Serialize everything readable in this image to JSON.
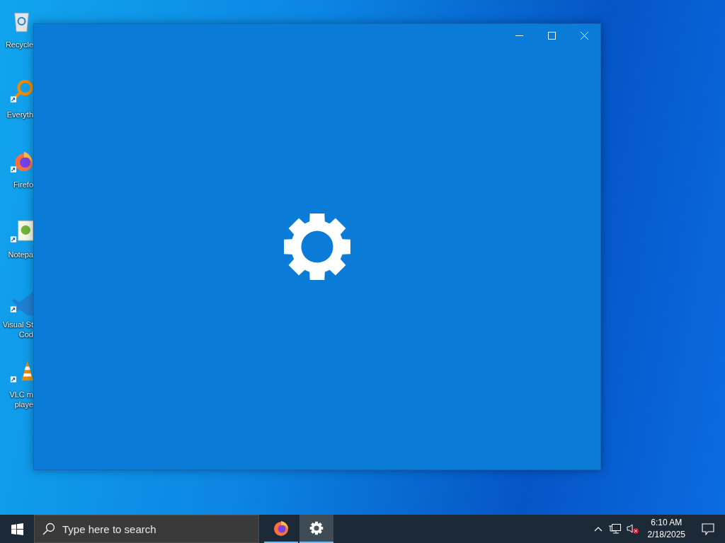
{
  "desktop_icons": [
    {
      "kind": "recycle-bin",
      "lines": [
        "Recycle"
      ]
    },
    {
      "kind": "search-app",
      "lines": [
        "Everyth"
      ]
    },
    {
      "kind": "browser",
      "lines": [
        "Firefo"
      ]
    },
    {
      "kind": "notepad",
      "lines": [
        "Notepa"
      ]
    },
    {
      "kind": "code-editor",
      "lines": [
        "Visual St",
        "Cod"
      ]
    },
    {
      "kind": "media-player",
      "lines": [
        "VLC m",
        "playe"
      ]
    }
  ],
  "window": {
    "controls": [
      {
        "kind": "minimize"
      },
      {
        "kind": "maximize"
      },
      {
        "kind": "close"
      }
    ]
  },
  "taskbar": {
    "search": {
      "placeholder": "Type here to search"
    },
    "apps": [
      {
        "kind": "browser",
        "selected": false
      },
      {
        "kind": "settings",
        "selected": true
      }
    ],
    "tray": {
      "volume_muted": true,
      "time": "6:10 AM",
      "date": "2/18/2025"
    }
  }
}
